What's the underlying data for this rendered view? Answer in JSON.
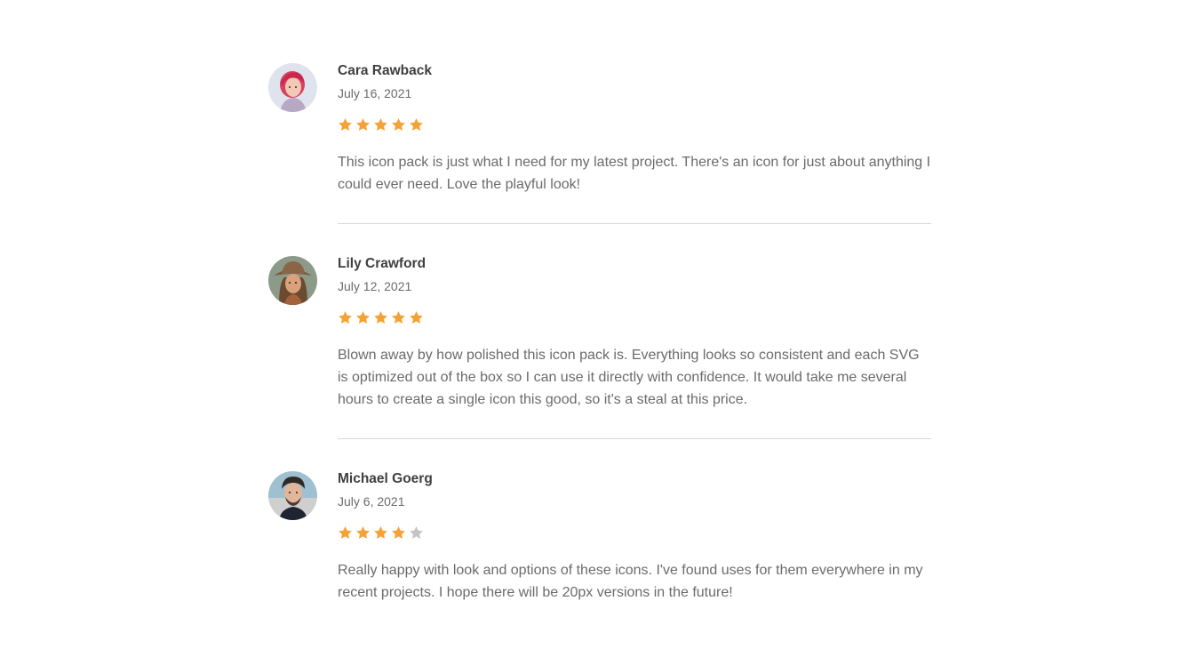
{
  "colors": {
    "star_filled": "#f4a236",
    "star_empty": "#c4c4c4",
    "name": "#3f3f3f",
    "text": "#6b6b6b",
    "divider": "#d9d9d9"
  },
  "reviews": [
    {
      "name": "Cara Rawback",
      "date": "July 16, 2021",
      "rating": 5,
      "max_rating": 5,
      "avatar_icon": "avatar-photo-woman-pink-hair",
      "text": "This icon pack is just what I need for my latest project. There's an icon for just about anything I could ever need. Love the playful look!"
    },
    {
      "name": "Lily Crawford",
      "date": "July 12, 2021",
      "rating": 5,
      "max_rating": 5,
      "avatar_icon": "avatar-photo-woman-hat",
      "text": "Blown away by how polished this icon pack is. Everything looks so consistent and each SVG is optimized out of the box so I can use it directly with confidence. It would take me several hours to create a single icon this good, so it's a steal at this price."
    },
    {
      "name": "Michael Goerg",
      "date": "July 6, 2021",
      "rating": 4,
      "max_rating": 5,
      "avatar_icon": "avatar-photo-man",
      "text": "Really happy with look and options of these icons. I've found uses for them everywhere in my recent projects. I hope there will be 20px versions in the future!"
    }
  ]
}
